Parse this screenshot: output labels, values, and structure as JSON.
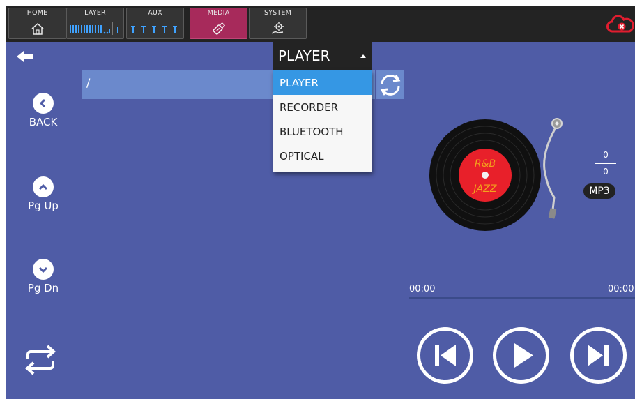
{
  "topbar": {
    "tabs": [
      {
        "label": "HOME",
        "icon": "home-icon"
      },
      {
        "label": "LAYER",
        "icon": "layer-meters-icon"
      },
      {
        "label": "AUX",
        "icon": "aux-meters-icon"
      },
      {
        "label": "MEDIA",
        "icon": "usb-drive-icon",
        "active": true
      },
      {
        "label": "SYSTEM",
        "icon": "gear-hand-icon"
      }
    ],
    "cloud_status_icon": "cloud-disconnected-icon"
  },
  "source_dropdown": {
    "selected": "PLAYER",
    "options": [
      "PLAYER",
      "RECORDER",
      "BLUETOOTH",
      "OPTICAL"
    ]
  },
  "browser": {
    "path": "/",
    "refresh_icon": "refresh-icon"
  },
  "sidebar": {
    "back": {
      "label": "BACK",
      "icon": "chevron-left-icon"
    },
    "page_up": {
      "label": "Pg Up",
      "icon": "chevron-up-icon"
    },
    "page_down": {
      "label": "Pg Dn",
      "icon": "chevron-down-icon"
    },
    "repeat_icon": "repeat-icon"
  },
  "player": {
    "record_label_top": "R&B",
    "record_label_bottom": "JAZZ",
    "track_index": "0",
    "track_total": "0",
    "format": "MP3",
    "elapsed": "00:00",
    "duration": "00:00",
    "progress": 0
  },
  "colors": {
    "background": "#4f5ca6",
    "topbar": "#232323",
    "active_tab": "#a72a5b",
    "selected_option": "#3597e4",
    "path_bar": "#6b89cc",
    "record_label": "#e8202a"
  }
}
